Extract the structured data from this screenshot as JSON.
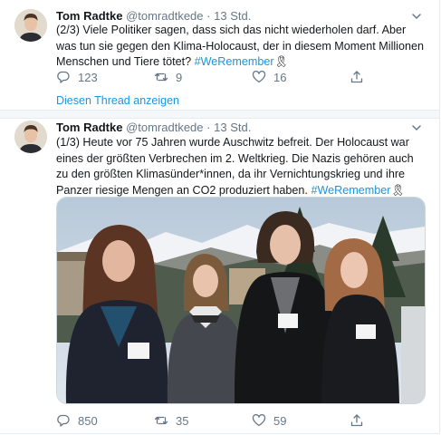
{
  "tweets": [
    {
      "name": "Tom Radtke",
      "handle": "@tomradtkede",
      "dot": "·",
      "time": "13 Std.",
      "text": "(2/3) Viele Politiker sagen, dass sich das nicht wiederholen darf. Aber was tun sie gegen den Klima-Holocaust, der in diesem Moment Millionen Menschen und Tiere tötet?",
      "hashtag": "#WeRemember",
      "emoji": "🎗",
      "replies": "123",
      "retweets": "9",
      "likes": "16",
      "show_thread": "Diesen Thread anzeigen"
    },
    {
      "name": "Tom Radtke",
      "handle": "@tomradtkede",
      "dot": "·",
      "time": "13 Std.",
      "text": "(1/3) Heute vor 75 Jahren wurde Auschwitz befreit. Der Holocaust war eines der größten Verbrechen im 2. Weltkrieg. Die Nazis gehören auch zu den größten Klimasünder*innen, da ihr Vernichtungskrieg und ihre Panzer riesige Mengen an CO2 produziert haben.",
      "hashtag": "#WeRemember",
      "emoji": "🎗",
      "replies": "850",
      "retweets": "35",
      "likes": "59"
    }
  ],
  "icons": {
    "reply": "reply-icon",
    "retweet": "retweet-icon",
    "like": "heart-icon",
    "share": "share-icon",
    "caret": "chevron-down-icon"
  },
  "colors": {
    "link": "#1b95e0",
    "muted": "#657786",
    "border": "#e6ecf0"
  }
}
